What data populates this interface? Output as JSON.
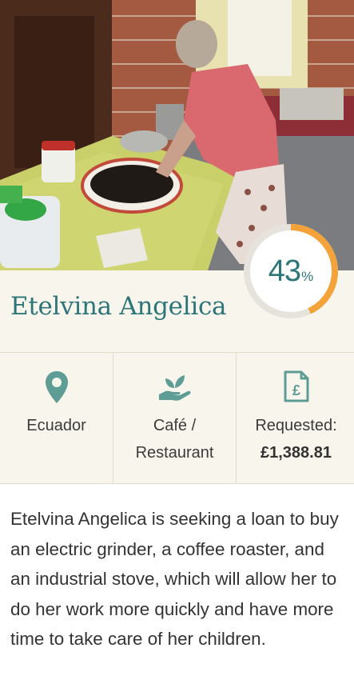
{
  "borrower": {
    "name": "Etelvina Angelica",
    "funded_percent": 43,
    "percent_symbol": "%"
  },
  "stats": {
    "location": {
      "icon": "map-pin-icon",
      "label": "Ecuador"
    },
    "sector": {
      "icon": "hand-plant-icon",
      "line1": "Café /",
      "line2": "Restaurant"
    },
    "request": {
      "icon": "pound-document-icon",
      "label": "Requested:",
      "amount": "£1,388.81"
    }
  },
  "description": "Etelvina Angelica is seeking a loan to buy an electric grinder, a coffee roaster, and an industrial stove, which will allow her to do her work more quickly and have more time to take care of her children.",
  "colors": {
    "accent_teal": "#2d7579",
    "progress_orange": "#f4a23a",
    "panel_cream": "#f8f5ec",
    "icon_teal": "#5d9d96"
  }
}
